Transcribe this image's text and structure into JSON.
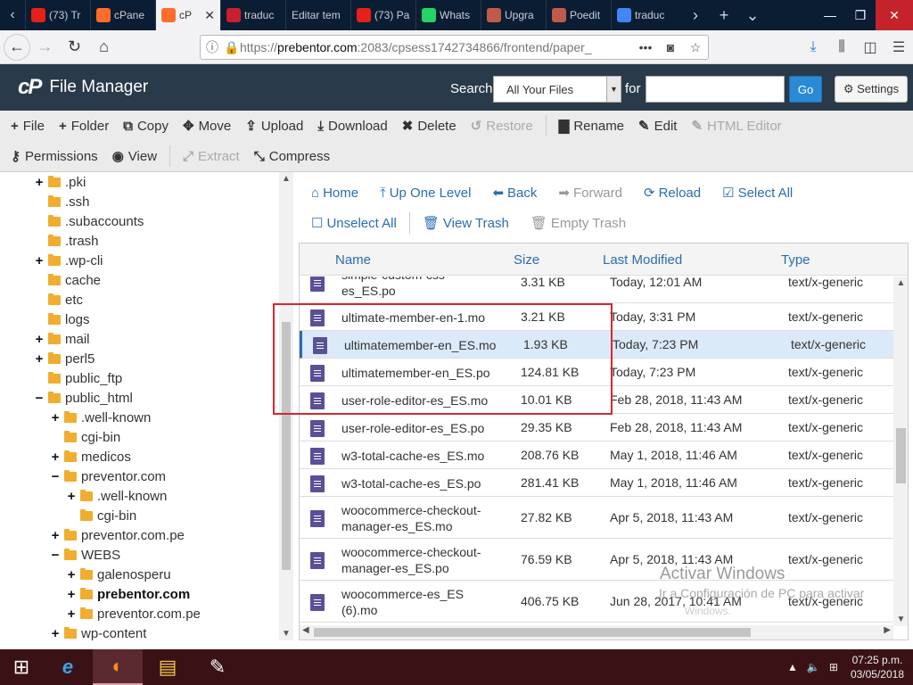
{
  "browser": {
    "tabs": [
      {
        "label": "(73) Tr",
        "fav": "youtube-icon",
        "color": "#e62117"
      },
      {
        "label": "cPane",
        "fav": "cpanel-icon",
        "color": "#ff6c2c"
      },
      {
        "label": "cP",
        "fav": "cpanel-icon",
        "color": "#ff6c2c",
        "active": true
      },
      {
        "label": "traduc",
        "fav": "wordreference-icon",
        "color": "#c8202e"
      },
      {
        "label": "Editar tem",
        "fav": "none",
        "color": "#555"
      },
      {
        "label": "(73) Pa",
        "fav": "youtube-icon",
        "color": "#e62117"
      },
      {
        "label": "Whats",
        "fav": "whatsapp-icon",
        "color": "#25d366"
      },
      {
        "label": "Upgra",
        "fav": "poedit-icon",
        "color": "#c05a4a"
      },
      {
        "label": "Poedit",
        "fav": "poedit-icon",
        "color": "#c05a4a"
      },
      {
        "label": "traduc",
        "fav": "google-icon",
        "color": "#4285f4"
      }
    ],
    "url_prefix": "https://",
    "url_host": "prebentor.com",
    "url_rest": ":2083/cpsess1742734866/frontend/paper_"
  },
  "header": {
    "title": "File Manager",
    "search_label": "Search",
    "search_scope": "All Your Files",
    "for_label": "for",
    "go_label": "Go",
    "settings_label": "Settings"
  },
  "toolbar": {
    "row1": [
      {
        "label": "File",
        "icon": "plus-icon",
        "glyph": "+",
        "enabled": true
      },
      {
        "label": "Folder",
        "icon": "plus-icon",
        "glyph": "+",
        "enabled": true
      },
      {
        "label": "Copy",
        "icon": "copy-icon",
        "glyph": "⧉",
        "enabled": true
      },
      {
        "label": "Move",
        "icon": "move-icon",
        "glyph": "✥",
        "enabled": true
      },
      {
        "label": "Upload",
        "icon": "upload-icon",
        "glyph": "⇪",
        "enabled": true
      },
      {
        "label": "Download",
        "icon": "download-icon",
        "glyph": "⤓",
        "enabled": true
      },
      {
        "label": "Delete",
        "icon": "delete-icon",
        "glyph": "✖",
        "enabled": true
      },
      {
        "label": "Restore",
        "icon": "restore-icon",
        "glyph": "↺",
        "enabled": false
      },
      {
        "label": "Rename",
        "icon": "rename-icon",
        "glyph": "▇",
        "enabled": true
      },
      {
        "label": "Edit",
        "icon": "pencil-icon",
        "glyph": "✎",
        "enabled": true
      },
      {
        "label": "HTML Editor",
        "icon": "html-editor-icon",
        "glyph": "✎",
        "enabled": false
      }
    ],
    "row2": [
      {
        "label": "Permissions",
        "icon": "key-icon",
        "glyph": "⚷",
        "enabled": true
      },
      {
        "label": "View",
        "icon": "eye-icon",
        "glyph": "◉",
        "enabled": true
      },
      {
        "label": "Extract",
        "icon": "extract-icon",
        "glyph": "⤢",
        "enabled": false
      },
      {
        "label": "Compress",
        "icon": "compress-icon",
        "glyph": "⤡",
        "enabled": true
      }
    ]
  },
  "tree": [
    {
      "label": ".pki",
      "toggle": "+",
      "depth": 0
    },
    {
      "label": ".ssh",
      "toggle": "",
      "depth": 0
    },
    {
      "label": ".subaccounts",
      "toggle": "",
      "depth": 0
    },
    {
      "label": ".trash",
      "toggle": "",
      "depth": 0
    },
    {
      "label": ".wp-cli",
      "toggle": "+",
      "depth": 0
    },
    {
      "label": "cache",
      "toggle": "",
      "depth": 0
    },
    {
      "label": "etc",
      "toggle": "",
      "depth": 0
    },
    {
      "label": "logs",
      "toggle": "",
      "depth": 0
    },
    {
      "label": "mail",
      "toggle": "+",
      "depth": 0
    },
    {
      "label": "perl5",
      "toggle": "+",
      "depth": 0
    },
    {
      "label": "public_ftp",
      "toggle": "",
      "depth": 0
    },
    {
      "label": "public_html",
      "toggle": "−",
      "depth": 0,
      "open": true
    },
    {
      "label": ".well-known",
      "toggle": "+",
      "depth": 1
    },
    {
      "label": "cgi-bin",
      "toggle": "",
      "depth": 1
    },
    {
      "label": "medicos",
      "toggle": "+",
      "depth": 1
    },
    {
      "label": "preventor.com",
      "toggle": "−",
      "depth": 1,
      "open": true
    },
    {
      "label": ".well-known",
      "toggle": "+",
      "depth": 2
    },
    {
      "label": "cgi-bin",
      "toggle": "",
      "depth": 2
    },
    {
      "label": "preventor.com.pe",
      "toggle": "+",
      "depth": 1
    },
    {
      "label": "WEBS",
      "toggle": "−",
      "depth": 1,
      "open": true
    },
    {
      "label": "galenosperu",
      "toggle": "+",
      "depth": 2
    },
    {
      "label": "prebentor.com",
      "toggle": "+",
      "depth": 2,
      "bold": true
    },
    {
      "label": "preventor.com.pe",
      "toggle": "+",
      "depth": 2
    },
    {
      "label": "wp-content",
      "toggle": "+",
      "depth": 1
    }
  ],
  "filenav": {
    "row1": [
      {
        "label": "Home",
        "icon": "home-icon",
        "glyph": "⌂",
        "enabled": true
      },
      {
        "label": "Up One Level",
        "icon": "up-arrow-icon",
        "glyph": "⤒",
        "enabled": true
      },
      {
        "label": "Back",
        "icon": "back-arrow-icon",
        "glyph": "⬅",
        "enabled": true
      },
      {
        "label": "Forward",
        "icon": "forward-arrow-icon",
        "glyph": "➡",
        "enabled": false
      },
      {
        "label": "Reload",
        "icon": "reload-icon",
        "glyph": "⟳",
        "enabled": true
      },
      {
        "label": "Select All",
        "icon": "checkbox-checked-icon",
        "glyph": "☑",
        "enabled": true
      }
    ],
    "row2": [
      {
        "label": "Unselect All",
        "icon": "checkbox-empty-icon",
        "glyph": "☐",
        "enabled": true
      },
      {
        "label": "View Trash",
        "icon": "trash-icon",
        "glyph": "🗑",
        "enabled": true
      },
      {
        "label": "Empty Trash",
        "icon": "empty-trash-icon",
        "glyph": "🗑",
        "enabled": false
      }
    ]
  },
  "table": {
    "headers": {
      "name": "Name",
      "size": "Size",
      "modified": "Last Modified",
      "type": "Type"
    },
    "rows": [
      {
        "name": "simple-custom-css-es_ES.po",
        "name_lines": [
          "simple-custom-css-",
          "es_ES.po"
        ],
        "size": "3.31 KB",
        "modified": "Today, 12:01 AM",
        "type": "text/x-generic",
        "h": 46
      },
      {
        "name": "ultimate-member-en-1.mo",
        "size": "3.21 KB",
        "modified": "Today, 3:31 PM",
        "type": "text/x-generic",
        "h": 31
      },
      {
        "name": "ultimatemember-en_ES.mo",
        "size": "1.93 KB",
        "modified": "Today, 7:23 PM",
        "type": "text/x-generic",
        "h": 31,
        "selected": true
      },
      {
        "name": "ultimatemember-en_ES.po",
        "size": "124.81 KB",
        "modified": "Today, 7:23 PM",
        "type": "text/x-generic",
        "h": 31
      },
      {
        "name": "user-role-editor-es_ES.mo",
        "size": "10.01 KB",
        "modified": "Feb 28, 2018, 11:43 AM",
        "type": "text/x-generic",
        "h": 31
      },
      {
        "name": "user-role-editor-es_ES.po",
        "size": "29.35 KB",
        "modified": "Feb 28, 2018, 11:43 AM",
        "type": "text/x-generic",
        "h": 31
      },
      {
        "name": "w3-total-cache-es_ES.mo",
        "size": "208.76 KB",
        "modified": "May 1, 2018, 11:46 AM",
        "type": "text/x-generic",
        "h": 31
      },
      {
        "name": "w3-total-cache-es_ES.po",
        "size": "281.41 KB",
        "modified": "May 1, 2018, 11:46 AM",
        "type": "text/x-generic",
        "h": 31
      },
      {
        "name": "woocommerce-checkout-manager-es_ES.mo",
        "name_lines": [
          "woocommerce-checkout-",
          "manager-es_ES.mo"
        ],
        "size": "27.82 KB",
        "modified": "Apr 5, 2018, 11:43 AM",
        "type": "text/x-generic",
        "h": 47
      },
      {
        "name": "woocommerce-checkout-manager-es_ES.po",
        "name_lines": [
          "woocommerce-checkout-",
          "manager-es_ES.po"
        ],
        "size": "76.59 KB",
        "modified": "Apr 5, 2018, 11:43 AM",
        "type": "text/x-generic",
        "h": 47
      },
      {
        "name": "woocommerce-es_ES (6).mo",
        "name_lines": [
          "woocommerce-es_ES",
          "(6).mo"
        ],
        "size": "406.75 KB",
        "modified": "Jun 28, 2017, 10:41 AM",
        "type": "text/x-generic",
        "h": 47
      }
    ]
  },
  "watermark": {
    "line1": "Activar Windows",
    "line2": "Ir a Configuración de PC para activar",
    "line3": "Windows."
  },
  "taskbar": {
    "apps": [
      {
        "name": "windows-start-icon",
        "glyph": "⊞"
      },
      {
        "name": "internet-explorer-icon",
        "glyph": "e"
      },
      {
        "name": "firefox-icon",
        "glyph": "◐",
        "active": true
      },
      {
        "name": "file-explorer-icon",
        "glyph": "▤"
      },
      {
        "name": "poedit-icon",
        "glyph": "✎"
      }
    ],
    "time": "07:25 p.m.",
    "date": "03/05/2018"
  },
  "colors": {
    "header_bg": "#293a4a",
    "link": "#2a6db2",
    "selected_row": "#dbeaf9",
    "annotation_box": "#d9262e"
  }
}
